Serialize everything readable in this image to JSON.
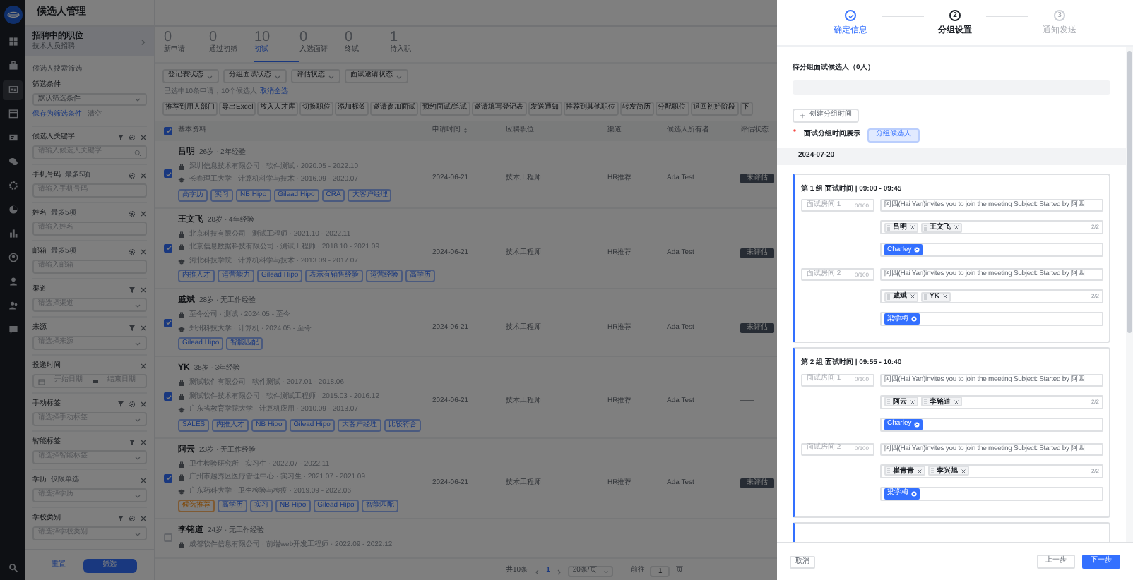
{
  "app": {
    "title": "候选人管理"
  },
  "rail_items": [
    {
      "selected": false
    },
    {
      "selected": false
    },
    {
      "selected": true
    },
    {
      "selected": false
    },
    {
      "selected": false
    },
    {
      "selected": false
    },
    {
      "selected": false
    },
    {
      "selected": false
    },
    {
      "selected": false
    },
    {
      "selected": false
    },
    {
      "selected": false
    },
    {
      "selected": false
    },
    {
      "selected": false
    }
  ],
  "job": {
    "title": "招聘中的职位",
    "subtitle": "技术人员招聘"
  },
  "filter_panel": {
    "heading": "候选人搜索筛选",
    "condition_label": "筛选条件",
    "condition_value": "默认筛选条件",
    "save_link": "保存为筛选条件",
    "clear_link": "清空",
    "fields": [
      {
        "label": "候选人关键字",
        "kind": "search",
        "placeholder": "请输入候选人关键字",
        "filterable": true,
        "configurable": true
      },
      {
        "label": "手机号码",
        "hint": "最多5项",
        "kind": "input",
        "placeholder": "请输入手机号码",
        "filterable": false,
        "configurable": true
      },
      {
        "label": "姓名",
        "hint": "最多5项",
        "kind": "input",
        "placeholder": "请输入姓名",
        "filterable": false,
        "configurable": true
      },
      {
        "label": "邮箱",
        "hint": "最多5项",
        "kind": "input",
        "placeholder": "请输入邮箱",
        "filterable": false,
        "configurable": true
      },
      {
        "label": "渠道",
        "kind": "select",
        "placeholder": "请选择渠道",
        "filterable": true,
        "configurable": false
      },
      {
        "label": "来源",
        "kind": "select",
        "placeholder": "请选择来源",
        "filterable": true,
        "configurable": false
      },
      {
        "label": "投递时间",
        "kind": "date_range",
        "placeholder": "开始日期",
        "placeholder_end": "结束日期",
        "filterable": false,
        "configurable": false
      },
      {
        "label": "手动标签",
        "kind": "select",
        "placeholder": "请选择手动标签",
        "filterable": true,
        "configurable": true
      },
      {
        "label": "智能标签",
        "kind": "select",
        "placeholder": "请选择智能标签",
        "filterable": true,
        "configurable": false
      },
      {
        "label": "学历",
        "hint": "仅限单选",
        "kind": "select",
        "placeholder": "请选择学历",
        "filterable": false,
        "configurable": false
      },
      {
        "label": "学校类别",
        "kind": "select",
        "placeholder": "请选择学校类别",
        "filterable": true,
        "configurable": true
      }
    ],
    "reset_button": "重置",
    "apply_button": "筛选"
  },
  "stages": [
    {
      "count": "0",
      "label": "新申请",
      "selected": false
    },
    {
      "count": "0",
      "label": "通过初筛",
      "selected": false
    },
    {
      "count": "10",
      "label": "初试",
      "selected": true
    },
    {
      "count": "0",
      "label": "入选面评",
      "selected": false
    },
    {
      "count": "0",
      "label": "终试",
      "selected": false
    },
    {
      "count": "1",
      "label": "待入职",
      "selected": false
    }
  ],
  "dropdown_filters": [
    "登记表状态",
    "分组面试状态",
    "评估状态",
    "面试邀请状态"
  ],
  "selection": {
    "text": "已选中10条申请，10个候选人",
    "link": "取消全选"
  },
  "actions": [
    "推荐到用人部门",
    "导出Excel",
    "放入人才库",
    "切换职位",
    "添加标签",
    "邀请参加面试",
    "预约面试/笔试",
    "邀请填写登记表",
    "发送通知",
    "推荐到其他职位",
    "转发简历",
    "分配职位",
    "退回初始阶段",
    "下"
  ],
  "table": {
    "header_checked": true,
    "columns": [
      "基本资料",
      "申请时间",
      "应聘职位",
      "渠道",
      "候选人所有者",
      "评估状态"
    ],
    "rows": [
      {
        "checked": true,
        "name": "吕明",
        "meta": "26岁 · 2年经验",
        "experiences": [
          {
            "kind": "work",
            "text": "深圳信息技术有限公司 · 软件测试 · 2020.05 - 2022.10"
          },
          {
            "kind": "education",
            "text": "长春理工大学 · 计算机科学与技术 · 2016.09 - 2020.07"
          }
        ],
        "tags": [
          "高学历",
          "实习",
          "NB Hipo",
          "Gilead Hipo",
          "CRA",
          "大客户经理"
        ],
        "applied": "2024-06-21",
        "position": "技术工程师",
        "channel": "HR推荐",
        "owner": "Ada Test",
        "status": {
          "text": "未评估",
          "kind": "badge"
        }
      },
      {
        "checked": true,
        "name": "王文飞",
        "meta": "28岁 · 4年经验",
        "experiences": [
          {
            "kind": "work",
            "text": "北京科技有限公司 · 测试工程师 · 2021.10 - 2022.11"
          },
          {
            "kind": "work",
            "text": "北京信息数据科技有限公司 · 测试工程师 · 2018.10 - 2021.09"
          },
          {
            "kind": "education",
            "text": "河北科技学院 · 计算机科学与技术 · 2013.09 - 2017.07"
          }
        ],
        "tags": [
          "内推人才",
          "运营能力",
          "Gilead Hipo",
          "表示有销售经验",
          "运营经验",
          "高学历"
        ],
        "applied": "2024-06-21",
        "position": "技术工程师",
        "channel": "HR推荐",
        "owner": "Ada Test",
        "status": {
          "text": "未评估",
          "kind": "badge"
        }
      },
      {
        "checked": true,
        "name": "戚斌",
        "meta": "28岁 · 无工作经验",
        "experiences": [
          {
            "kind": "work",
            "text": "至今公司 · 测试 · 2024.05 - 至今"
          },
          {
            "kind": "education",
            "text": "郑州科技大学 · 计算机 · 2024.05 - 至今"
          }
        ],
        "tags": [
          "Gilead Hipo",
          "智能匹配"
        ],
        "applied": "2024-06-21",
        "position": "技术工程师",
        "channel": "HR推荐",
        "owner": "Ada Test",
        "status": {
          "text": "未评估",
          "kind": "badge"
        }
      },
      {
        "checked": true,
        "name": "YK",
        "meta": "35岁 · 3年经验",
        "experiences": [
          {
            "kind": "work",
            "text": "测试软件有限公司 · 软件测试 · 2017.01 - 2018.06"
          },
          {
            "kind": "work",
            "text": "测试软件技术有限公司 · 软件测试工程师 · 2015.03 - 2016.12"
          },
          {
            "kind": "education",
            "text": "广东省教育学院大学 · 计算机应用 · 2010.09 - 2013.07"
          }
        ],
        "tags": [
          "SALES",
          "内推人才",
          "NB Hipo",
          "Gilead Hipo",
          "大客户经理",
          "比较符合"
        ],
        "applied": "2024-06-21",
        "position": "技术工程师",
        "channel": "HR推荐",
        "owner": "Ada Test",
        "status": {
          "text": "——",
          "kind": "text"
        }
      },
      {
        "checked": true,
        "name": "阿云",
        "meta": "23岁 · 无工作经验",
        "experiences": [
          {
            "kind": "work",
            "text": "卫生检验研究所 · 实习生 · 2022.07 - 2022.11"
          },
          {
            "kind": "work",
            "text": "广州市越秀区医疗管理中心 · 实习生 · 2021.07 - 2021.09"
          },
          {
            "kind": "education",
            "text": "广东药科大学 · 卫生检验与检疫 · 2019.09 - 2022.06"
          }
        ],
        "flagged_tag": "候选推荐",
        "tags": [
          "高学历",
          "实习",
          "NB Hipo",
          "Gilead Hipo",
          "智能匹配"
        ],
        "applied": "2024-06-21",
        "position": "技术工程师",
        "channel": "HR推荐",
        "owner": "Ada Test",
        "status": {
          "text": "未评估",
          "kind": "badge"
        }
      },
      {
        "checked": false,
        "name": "李铭道",
        "meta": "24岁 · 无工作经验",
        "experiences": [
          {
            "kind": "work",
            "text": "成都软件信息有限公司 · 前端web开发工程师 · 2022.09 - 2022.12"
          }
        ],
        "tags": []
      }
    ]
  },
  "pagination": {
    "total": "共10条",
    "page": "1",
    "page_size": "20条/页",
    "goto_label": "前往",
    "goto_value": "1",
    "goto_unit": "页"
  },
  "drawer": {
    "steps": [
      {
        "label": "确定信息",
        "done": true,
        "current": false
      },
      {
        "number": "2",
        "label": "分组设置",
        "done": false,
        "current": true
      },
      {
        "number": "3",
        "label": "通知发送",
        "done": false,
        "current": false
      }
    ],
    "pending_label": "待分组面试候选人（0人）",
    "add_button": "创建分组时间",
    "required_label": "面试分组时间展示",
    "group_button": "分组候选人",
    "date": "2024-07-20",
    "groups": [
      {
        "title": "第 1 组 面试时间 | 09:00 - 09:45",
        "rooms": [
          {
            "placeholder": "面试房间 1",
            "counter": "0/100",
            "invite": "阿四(Hai Yan)invites you to join the meeting Subject: Started by 阿四",
            "candidates": [
              "吕明",
              "王文飞"
            ],
            "count": "2/2",
            "interviewers": [
              "Charley"
            ]
          },
          {
            "placeholder": "面试房间 2",
            "counter": "0/100",
            "invite": "阿四(Hai Yan)invites you to join the meeting Subject: Started by 阿四",
            "candidates": [
              "戚斌",
              "YK"
            ],
            "count": "2/2",
            "interviewers": [
              "梁学梅"
            ]
          }
        ]
      },
      {
        "title": "第 2 组 面试时间 | 09:55 - 10:40",
        "rooms": [
          {
            "placeholder": "面试房间 1",
            "counter": "0/100",
            "invite": "阿四(Hai Yan)invites you to join the meeting Subject: Started by 阿四",
            "candidates": [
              "阿云",
              "李铭道"
            ],
            "count": "2/2",
            "interviewers": [
              "Charley"
            ]
          },
          {
            "placeholder": "面试房间 2",
            "counter": "0/100",
            "invite": "阿四(Hai Yan)invites you to join the meeting Subject: Started by 阿四",
            "candidates": [
              "崔青青",
              "李兴旭"
            ],
            "count": "2/2",
            "interviewers": [
              "梁学梅"
            ]
          }
        ]
      }
    ],
    "more_groups": true,
    "cancel_button": "取消",
    "prev_button": "上一步",
    "next_button": "下一步"
  }
}
